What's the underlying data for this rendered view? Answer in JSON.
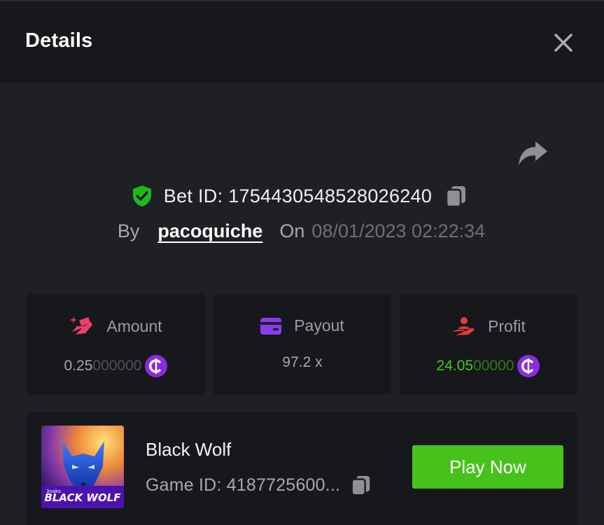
{
  "header": {
    "title": "Details",
    "close_icon": "close-icon"
  },
  "bet": {
    "id_label": "Bet ID: 1754430548528026240",
    "by_label": "By",
    "username": "pacoquiche",
    "on_label": "On",
    "datetime": "08/01/2023 02:22:34",
    "verified_icon": "shield-check-icon",
    "share_icon": "share-icon",
    "copy_icon": "copy-icon"
  },
  "stats": {
    "amount": {
      "label": "Amount",
      "value_main": "0.25",
      "value_trail": "000000",
      "icon": "money-hand-icon"
    },
    "payout": {
      "label": "Payout",
      "value": "97.2 x",
      "icon": "card-icon"
    },
    "profit": {
      "label": "Profit",
      "value_main": "24.05",
      "value_trail": "00000",
      "icon": "hand-user-icon"
    },
    "currency_icon": "coin-icon"
  },
  "game": {
    "name": "Black Wolf",
    "id_label": "Game ID: 4187725600...",
    "thumb_title": "BLACK WOLF",
    "thumb_small": "3oaks",
    "play_label": "Play Now"
  },
  "colors": {
    "background": "#1f2024",
    "panel": "#17181b",
    "green": "#46c21b",
    "coin": "#8b2be2",
    "pink": "#ef3c6b",
    "purple": "#8a3cf0",
    "red": "#e83a3a"
  }
}
